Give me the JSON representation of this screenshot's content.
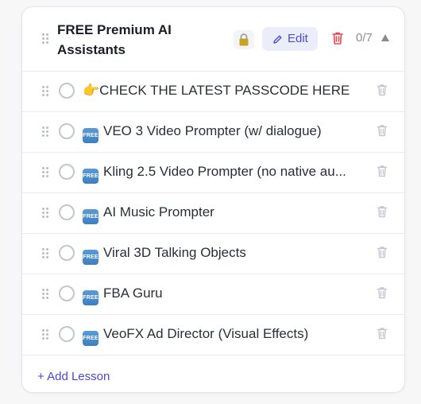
{
  "module": {
    "title": "FREE Premium AI Assistants",
    "edit_label": "Edit",
    "count": "0/7",
    "lock_icon": "lock-icon",
    "add_lesson_label": "+ Add Lesson"
  },
  "lessons": [
    {
      "prefix": "👉",
      "badge": "",
      "label": "CHECK THE LATEST PASSCODE HERE"
    },
    {
      "prefix": "",
      "badge": "FREE",
      "label": "VEO 3 Video Prompter (w/ dialogue)"
    },
    {
      "prefix": "",
      "badge": "FREE",
      "label": "Kling 2.5 Video Prompter (no native au..."
    },
    {
      "prefix": "",
      "badge": "FREE",
      "label": "AI Music Prompter"
    },
    {
      "prefix": "",
      "badge": "FREE",
      "label": "Viral 3D Talking Objects"
    },
    {
      "prefix": "",
      "badge": "FREE",
      "label": "FBA Guru"
    },
    {
      "prefix": "",
      "badge": "FREE",
      "label": "VeoFX Ad Director (Visual Effects)"
    }
  ],
  "colors": {
    "accent": "#4f46d8",
    "edit_bg": "#ebedfb",
    "delete_red": "#e5484d",
    "free_badge": "#4a8bcb"
  }
}
